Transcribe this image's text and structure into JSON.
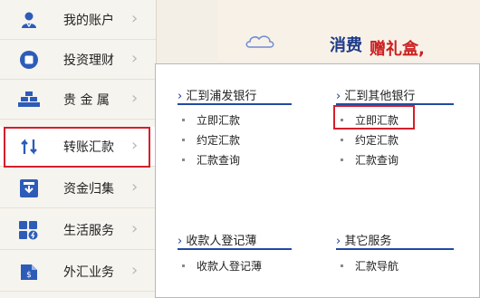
{
  "sidebar": {
    "items": [
      {
        "label": "我的账户",
        "icon": "user-icon"
      },
      {
        "label": "投资理财",
        "icon": "investment-icon"
      },
      {
        "label": "贵 金 属",
        "icon": "gold-bars-icon"
      },
      {
        "label": "转账汇款",
        "icon": "transfer-icon"
      },
      {
        "label": "资金归集",
        "icon": "fund-collection-icon"
      },
      {
        "label": "生活服务",
        "icon": "life-services-icon"
      },
      {
        "label": "外汇业务",
        "icon": "foreign-exchange-icon"
      }
    ],
    "chevron": "›"
  },
  "banner": {
    "text1": "消费",
    "text2": "赠礼盒,"
  },
  "dropdown": {
    "sections": [
      {
        "title": "汇到浦发银行",
        "links": [
          "立即汇款",
          "约定汇款",
          "汇款查询"
        ]
      },
      {
        "title": "汇到其他银行",
        "links": [
          "立即汇款",
          "约定汇款",
          "汇款查询"
        ]
      },
      {
        "title": "收款人登记薄",
        "links": [
          "收款人登记薄"
        ]
      },
      {
        "title": "其它服务",
        "links": [
          "汇款导航"
        ]
      }
    ],
    "section_arrow": "›"
  },
  "colors": {
    "accent": "#1f4aa3",
    "highlight": "#d51f2a"
  }
}
